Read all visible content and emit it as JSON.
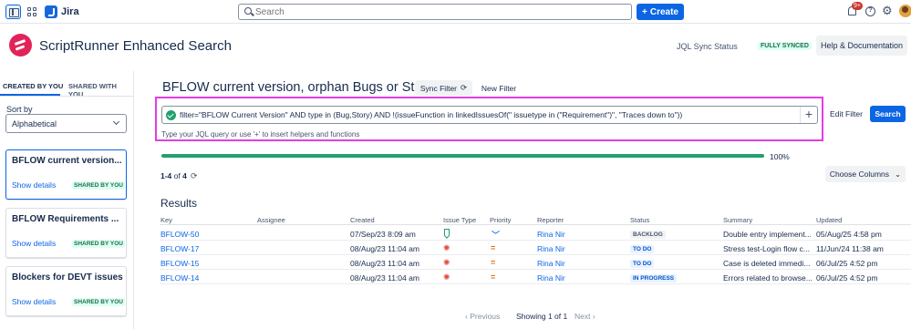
{
  "topnav": {
    "app_name": "Jira",
    "search_placeholder": "Search",
    "create_label": "Create",
    "notification_count": "9+"
  },
  "header": {
    "title": "ScriptRunner Enhanced Search",
    "sync_status_label": "JQL Sync Status",
    "sync_status_value": "FULLY SYNCED",
    "help_label": "Help & Documentation"
  },
  "sidebar": {
    "tabs": [
      "CREATED BY YOU",
      "SHARED WITH YOU"
    ],
    "sort_label": "Sort by",
    "sort_value": "Alphabetical",
    "filters": [
      {
        "name": "BFLOW current version...",
        "details": "Show details",
        "badge": "SHARED BY YOU"
      },
      {
        "name": "BFLOW Requirements ...",
        "details": "Show details",
        "badge": "SHARED BY YOU"
      },
      {
        "name": "Blockers for DEVT issues",
        "details": "Show details",
        "badge": "SHARED BY YOU"
      }
    ]
  },
  "main": {
    "filter_title": "BFLOW current version, orphan Bugs or Stories",
    "sync_filter_label": "Sync Filter",
    "new_filter_label": "New Filter",
    "jql": "filter=\"BFLOW Current Version\" AND type in (Bug,Story) AND !(issueFunction in linkedIssuesOf(\" issuetype in (\"Requirement\")\", \"Traces down to\"))",
    "jql_hint": "Type your JQL query or use '+' to insert helpers and functions",
    "edit_filter_label": "Edit Filter",
    "search_label": "Search",
    "progress": 100,
    "progress_label": "100%",
    "count_range": "1-4",
    "count_of": "of",
    "count_total": "4",
    "choose_columns_label": "Choose Columns",
    "results_title": "Results"
  },
  "table": {
    "columns": [
      "Key",
      "Assignee",
      "Created",
      "Issue Type",
      "Priority",
      "Reporter",
      "Status",
      "Summary",
      "Updated"
    ],
    "rows": [
      {
        "key": "BFLOW-50",
        "assignee": "",
        "created": "07/Sep/23 8:09 am",
        "type": "story",
        "priority": "low",
        "reporter": "Rina Nir",
        "status": "BACKLOG",
        "summary": "Double entry implement...",
        "updated": "05/Aug/25 4:58 pm"
      },
      {
        "key": "BFLOW-17",
        "assignee": "",
        "created": "08/Aug/23 11:04 am",
        "type": "bug",
        "priority": "medium",
        "reporter": "Rina Nir",
        "status": "TO DO",
        "summary": "Stress test-Login flow c...",
        "updated": "11/Jun/24 11:38 am"
      },
      {
        "key": "BFLOW-15",
        "assignee": "",
        "created": "08/Aug/23 11:04 am",
        "type": "bug",
        "priority": "medium",
        "reporter": "Rina Nir",
        "status": "TO DO",
        "summary": "Case is deleted immedi...",
        "updated": "06/Jul/25 4:52 pm"
      },
      {
        "key": "BFLOW-14",
        "assignee": "",
        "created": "08/Aug/23 11:04 am",
        "type": "bug",
        "priority": "medium",
        "reporter": "Rina Nir",
        "status": "IN PROGRESS",
        "summary": "Errors related to browse...",
        "updated": "06/Jul/25 4:52 pm"
      }
    ]
  },
  "pagination": {
    "previous_label": "Previous",
    "showing_label": "Showing 1 of 1",
    "next_label": "Next"
  }
}
